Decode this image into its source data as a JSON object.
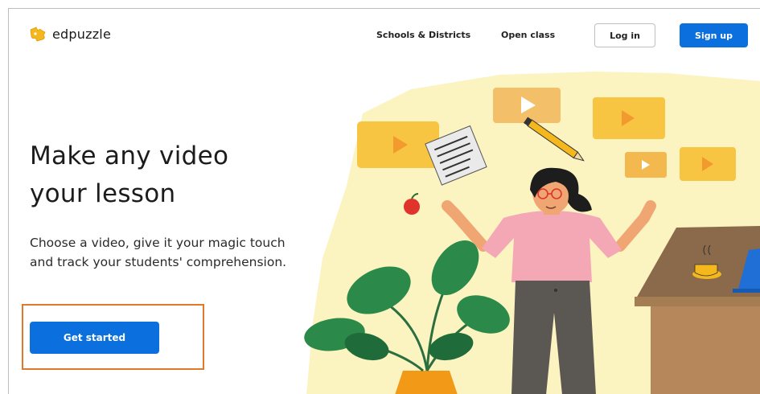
{
  "header": {
    "logo_text": "edpuzzle",
    "nav_links": [
      "Schools & Districts",
      "Open class"
    ],
    "login_label": "Log in",
    "signup_label": "Sign up"
  },
  "hero": {
    "headline_line1": "Make any video",
    "headline_line2": "your lesson",
    "subtext": "Choose a video, give it your magic touch and track your students' comprehension.",
    "cta_label": "Get started"
  },
  "colors": {
    "accent_blue": "#0b6fde",
    "highlight_orange": "#e07a2a",
    "logo_yellow": "#f5b81c",
    "illustration_bg": "#fbf3c0"
  },
  "icons": [
    "puzzle-logo-icon",
    "video-card-icon",
    "notepad-icon",
    "pencil-icon",
    "apple-icon",
    "coffee-cup-icon",
    "laptop-icon",
    "plant-icon"
  ]
}
